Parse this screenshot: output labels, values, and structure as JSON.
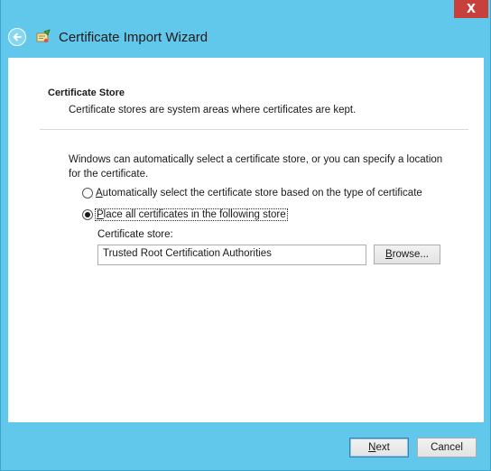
{
  "window": {
    "title": "Certificate Import Wizard",
    "close_glyph": "X"
  },
  "section": {
    "title": "Certificate Store",
    "description": "Certificate stores are system areas where certificates are kept."
  },
  "intro_text": "Windows can automatically select a certificate store, or you can specify a location for the certificate.",
  "options": [
    {
      "mnemonic": "A",
      "rest": "utomatically select the certificate store based on the type of certificate",
      "selected": false
    },
    {
      "mnemonic": "P",
      "rest": "lace all certificates in the following store",
      "selected": true
    }
  ],
  "store": {
    "label": "Certificate store:",
    "value": "Trusted Root Certification Authorities",
    "browse_mnemonic": "B",
    "browse_rest": "rowse..."
  },
  "footer": {
    "next_mnemonic": "N",
    "next_rest": "ext",
    "cancel_label": "Cancel"
  },
  "colors": {
    "frame": "#62c8eb",
    "close": "#c7403b",
    "content_bg": "#ffffff"
  },
  "icons": {
    "back": "back-arrow-icon",
    "wizard": "certificate-wizard-icon",
    "close": "close-icon"
  }
}
